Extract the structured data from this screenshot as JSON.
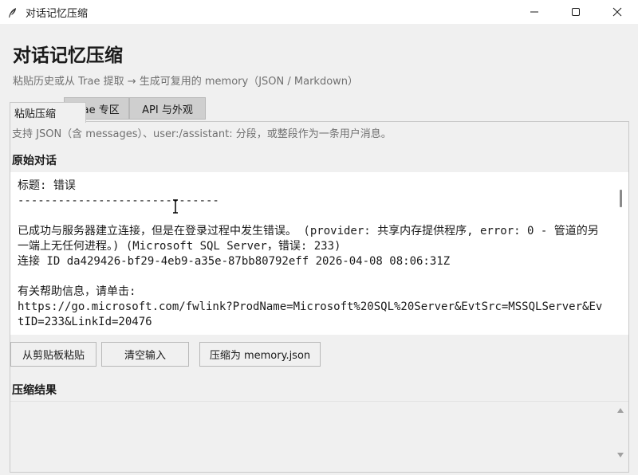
{
  "window": {
    "title": "对话记忆压缩"
  },
  "header": {
    "title": "对话记忆压缩",
    "subtitle": "粘贴历史或从 Trae 提取 → 生成可复用的 memory（JSON / Markdown）"
  },
  "tabs": [
    {
      "label": "粘贴压缩",
      "active": true
    },
    {
      "label": "Trae 专区",
      "active": false
    },
    {
      "label": "API 与外观",
      "active": false
    }
  ],
  "paste_tab": {
    "hint": "支持 JSON（含 messages）、user:/assistant: 分段，或整段作为一条用户消息。",
    "input_label": "原始对话",
    "input_value": "标题: 错误\n------------------------------\n\n已成功与服务器建立连接，但是在登录过程中发生错误。 (provider: 共享内存提供程序, error: 0 - 管道的另一端上无任何进程。) (Microsoft SQL Server，错误: 233)\n连接 ID da429426-bf29-4eb9-a35e-87bb80792eff 2026-04-08 08:06:31Z\n\n有关帮助信息，请单击:\nhttps://go.microsoft.com/fwlink?ProdName=Microsoft%20SQL%20Server&EvtSrc=MSSQLServer&EvtID=233&LinkId=20476",
    "buttons": {
      "paste": "从剪贴板粘贴",
      "clear": "清空输入",
      "compress": "压缩为 memory.json"
    },
    "output_label": "压缩结果",
    "output_value": ""
  },
  "icons": {
    "app": "feather-icon",
    "minimize": "minimize-icon",
    "maximize": "maximize-icon",
    "close": "close-icon"
  }
}
